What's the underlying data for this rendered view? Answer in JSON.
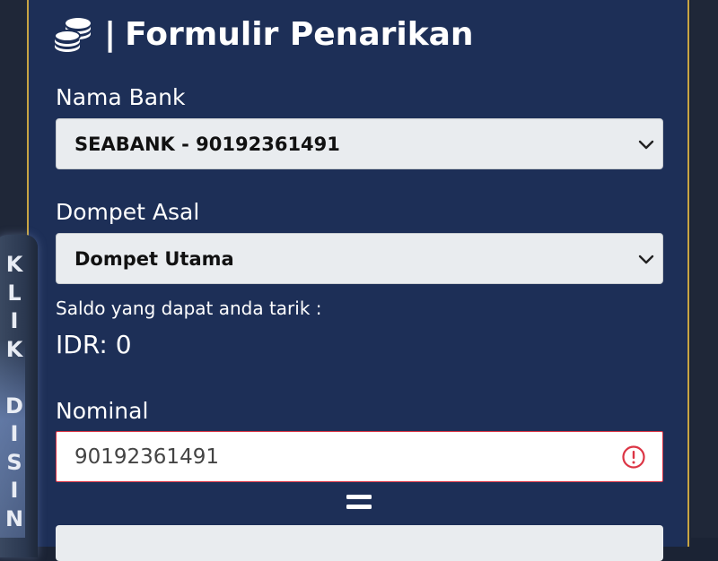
{
  "form": {
    "title": "Formulir Penarikan",
    "separator": "|",
    "bank_label": "Nama Bank",
    "bank_value": "SEABANK - 90192361491",
    "wallet_label": "Dompet Asal",
    "wallet_value": "Dompet Utama",
    "balance_label": "Saldo yang dapat anda tarik :",
    "balance_value": "IDR: 0",
    "nominal_label": "Nominal",
    "nominal_value": "90192361491"
  },
  "side_tab": {
    "letters": [
      "K",
      "L",
      "I",
      "K",
      "",
      "D",
      "I",
      "S",
      "I",
      "N"
    ]
  },
  "icons": {
    "header": "coins-icon",
    "select_arrow": "chevron-down-icon",
    "input_error": "exclamation-circle-icon",
    "between": "equals-icon"
  },
  "colors": {
    "panel": "#1d2f57",
    "accent_border": "#c8a443",
    "error": "#dc3545"
  }
}
